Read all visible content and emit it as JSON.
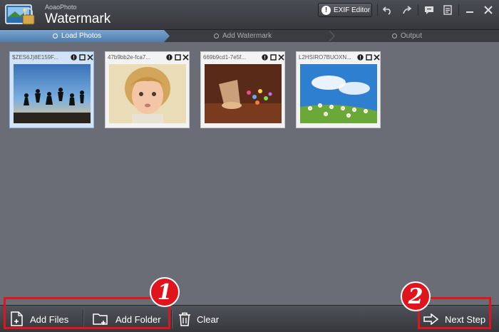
{
  "app": {
    "brand_small": "AoaoPhoto",
    "brand_big": "Watermark"
  },
  "toolbar": {
    "exif_label": "EXIF Editor",
    "icons": [
      "undo-icon",
      "redo-icon",
      "chat-icon",
      "register-icon",
      "minimize-icon",
      "close-icon"
    ]
  },
  "steps": [
    {
      "label": "Load Photos",
      "active": true
    },
    {
      "label": "Add Watermark",
      "active": false
    },
    {
      "label": "Output",
      "active": false
    }
  ],
  "thumbnails": [
    {
      "name": "$ZES6J)8E159F...",
      "selected": true
    },
    {
      "name": "47b9bb2e-fca7...",
      "selected": false
    },
    {
      "name": "669b9cd1-7e5f...",
      "selected": false
    },
    {
      "name": "L2HSIRO7BUOXN...",
      "selected": false
    }
  ],
  "bottom": {
    "add_files": "Add Files",
    "add_folder": "Add Folder",
    "clear": "Clear",
    "next_step": "Next Step"
  },
  "annotations": {
    "badge1": "1",
    "badge2": "2"
  },
  "colors": {
    "accent": "#5b8ec7",
    "annotation_red": "#e0141c",
    "background": "#6a6d76"
  }
}
